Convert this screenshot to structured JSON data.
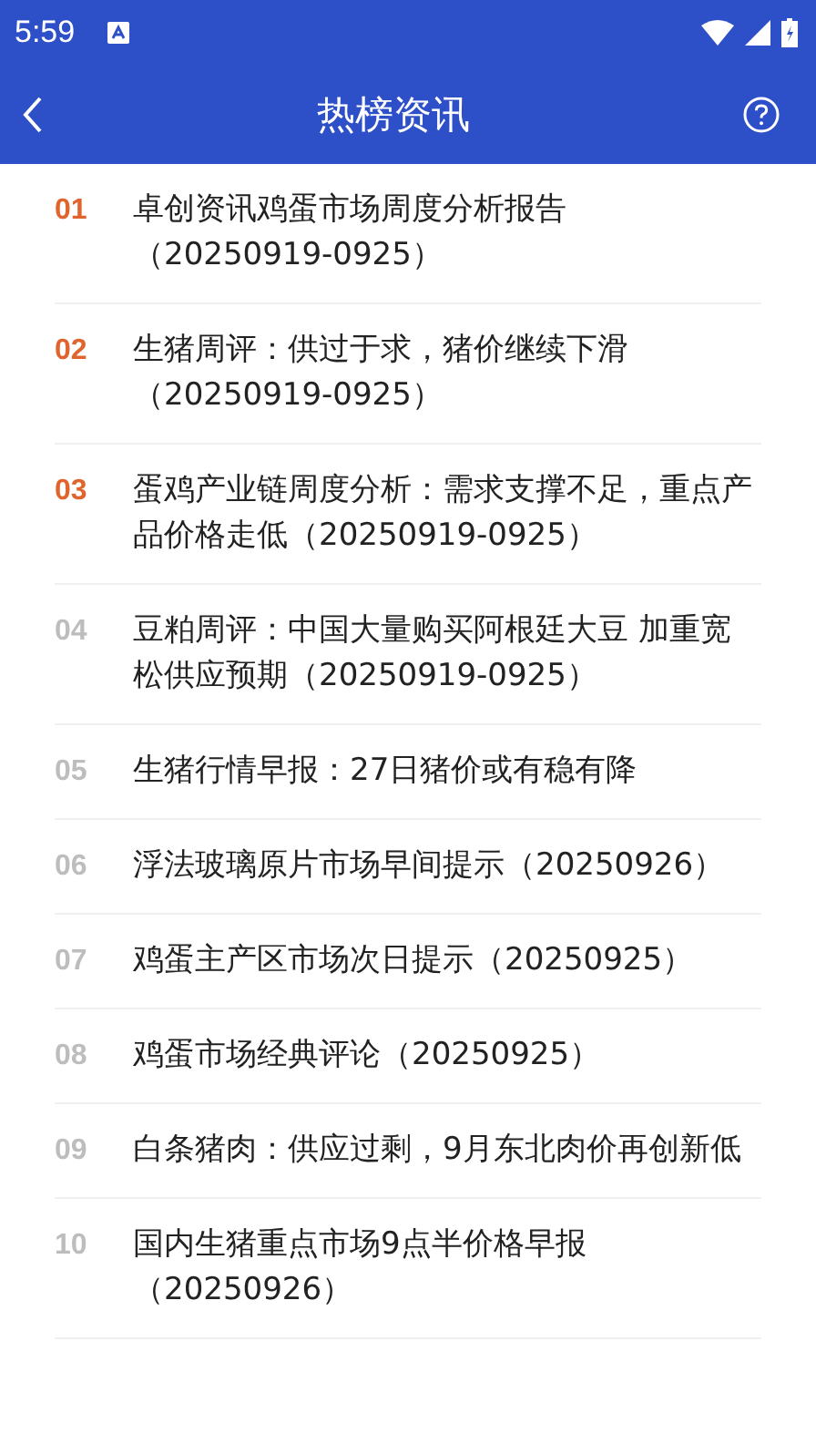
{
  "status_bar": {
    "time": "5:59"
  },
  "toolbar": {
    "title": "热榜资讯"
  },
  "items": [
    {
      "rank": "01",
      "hot": true,
      "title": "卓创资讯鸡蛋市场周度分析报告（20250919-0925）"
    },
    {
      "rank": "02",
      "hot": true,
      "title": "生猪周评：供过于求，猪价继续下滑（20250919-0925）"
    },
    {
      "rank": "03",
      "hot": true,
      "title": "蛋鸡产业链周度分析：需求支撑不足，重点产品价格走低（20250919-0925）"
    },
    {
      "rank": "04",
      "hot": false,
      "title": "豆粕周评：中国大量购买阿根廷大豆 加重宽松供应预期（20250919-0925）"
    },
    {
      "rank": "05",
      "hot": false,
      "title": "生猪行情早报：27日猪价或有稳有降"
    },
    {
      "rank": "06",
      "hot": false,
      "title": "浮法玻璃原片市场早间提示（20250926）"
    },
    {
      "rank": "07",
      "hot": false,
      "title": "鸡蛋主产区市场次日提示（20250925）"
    },
    {
      "rank": "08",
      "hot": false,
      "title": "鸡蛋市场经典评论（20250925）"
    },
    {
      "rank": "09",
      "hot": false,
      "title": "白条猪肉：供应过剩，9月东北肉价再创新低"
    },
    {
      "rank": "10",
      "hot": false,
      "title": "国内生猪重点市场9点半价格早报（20250926）"
    }
  ]
}
